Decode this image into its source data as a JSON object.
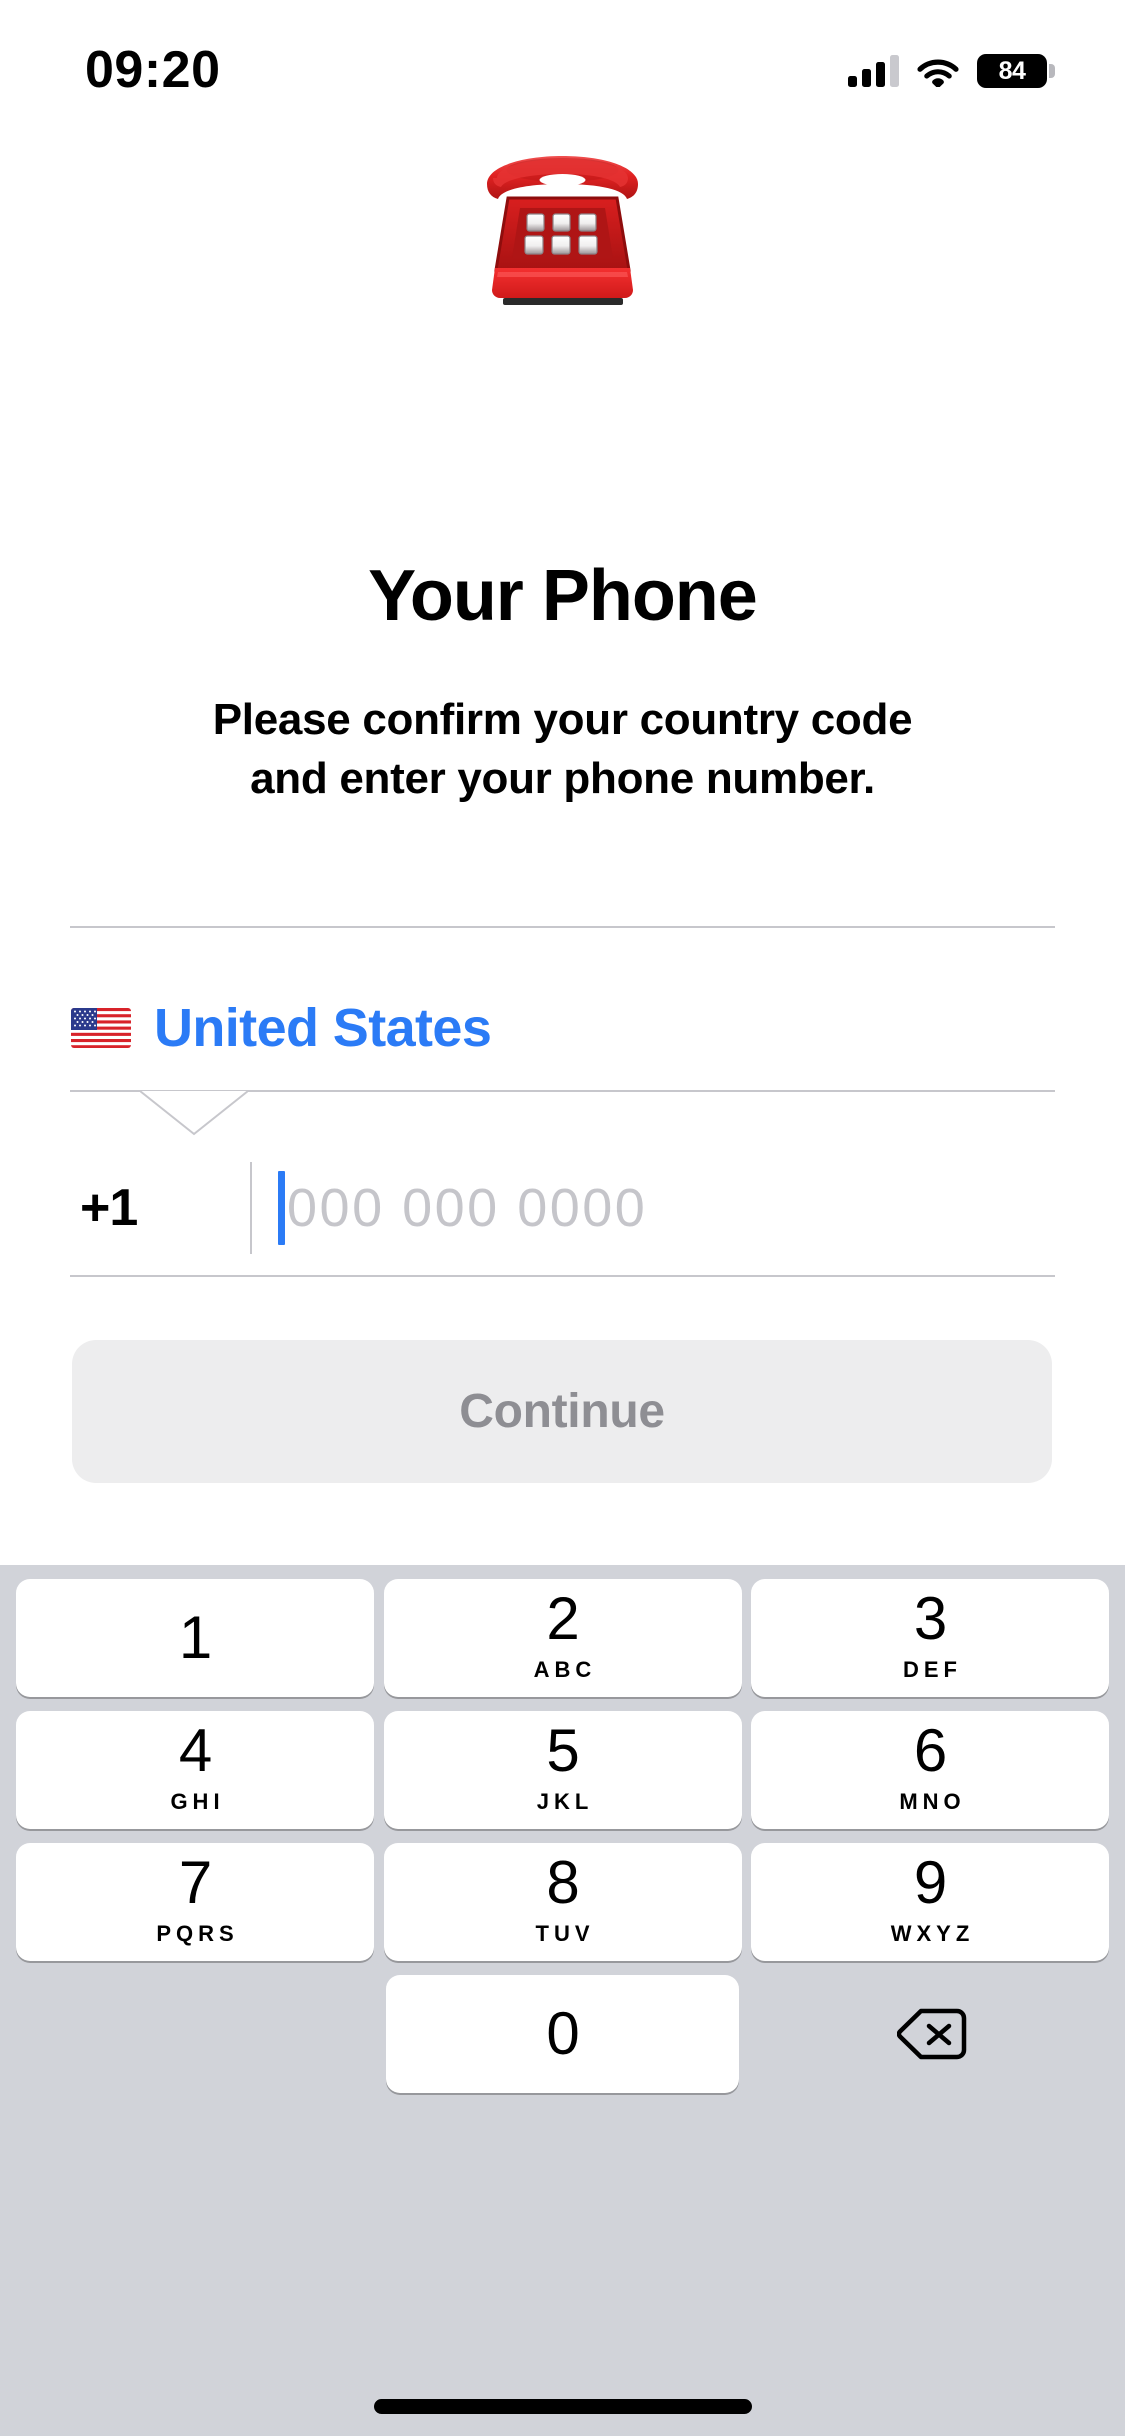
{
  "status_bar": {
    "time": "09:20",
    "battery_percent": "84",
    "signal_icon": "cellular-signal-icon",
    "wifi_icon": "wifi-icon",
    "battery_icon": "battery-icon"
  },
  "hero": {
    "emoji_name": "telephone-emoji",
    "emoji_char": "☎"
  },
  "content": {
    "title": "Your Phone",
    "subtitle_line1": "Please confirm your country code",
    "subtitle_line2": "and enter your phone number."
  },
  "country_selector": {
    "flag_name": "united-states-flag-emoji",
    "country_name": "United States",
    "accent_color": "#2B7BF6"
  },
  "phone_field": {
    "dial_code": "+1",
    "placeholder": "000 000 0000",
    "value": "",
    "caret_color": "#2B7BF6"
  },
  "actions": {
    "continue_label": "Continue",
    "continue_enabled": false,
    "continue_bg": "#EDEDEE",
    "continue_text_color": "#8E8E93"
  },
  "keyboard": {
    "background_color": "#D1D3D9",
    "key_color": "#FFFFFF",
    "rows": [
      [
        {
          "digit": "1",
          "letters": ""
        },
        {
          "digit": "2",
          "letters": "ABC"
        },
        {
          "digit": "3",
          "letters": "DEF"
        }
      ],
      [
        {
          "digit": "4",
          "letters": "GHI"
        },
        {
          "digit": "5",
          "letters": "JKL"
        },
        {
          "digit": "6",
          "letters": "MNO"
        }
      ],
      [
        {
          "digit": "7",
          "letters": "PQRS"
        },
        {
          "digit": "8",
          "letters": "TUV"
        },
        {
          "digit": "9",
          "letters": "WXYZ"
        }
      ]
    ],
    "zero_key": {
      "digit": "0",
      "letters": ""
    },
    "delete_icon_name": "backspace-delete-icon"
  },
  "home_indicator": {
    "name": "home-indicator"
  }
}
